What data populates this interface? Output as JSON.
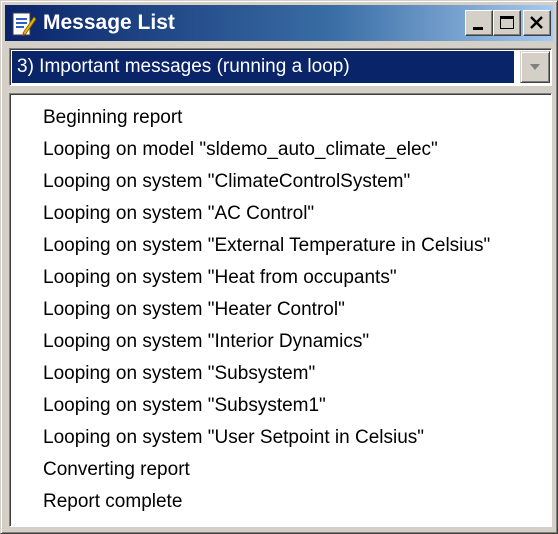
{
  "window": {
    "title": "Message List",
    "icon": "report-generator-icon"
  },
  "combo": {
    "selected": "3) Important messages (running a loop)"
  },
  "messages": [
    "Beginning report",
    "Looping on model \"sldemo_auto_climate_elec\"",
    "Looping on system \"ClimateControlSystem\"",
    "Looping on system \"AC Control\"",
    "Looping on system \"External Temperature in Celsius\"",
    "Looping on system \"Heat from occupants\"",
    "Looping on system \"Heater Control\"",
    "Looping on system \"Interior Dynamics\"",
    "Looping on system \"Subsystem\"",
    "Looping on system \"Subsystem1\"",
    "Looping on system \"User Setpoint in Celsius\"",
    "Converting report",
    "Report complete"
  ],
  "colors": {
    "titlebar": "#0a246a",
    "selection": "#0a246a",
    "face": "#d4d0c8"
  }
}
